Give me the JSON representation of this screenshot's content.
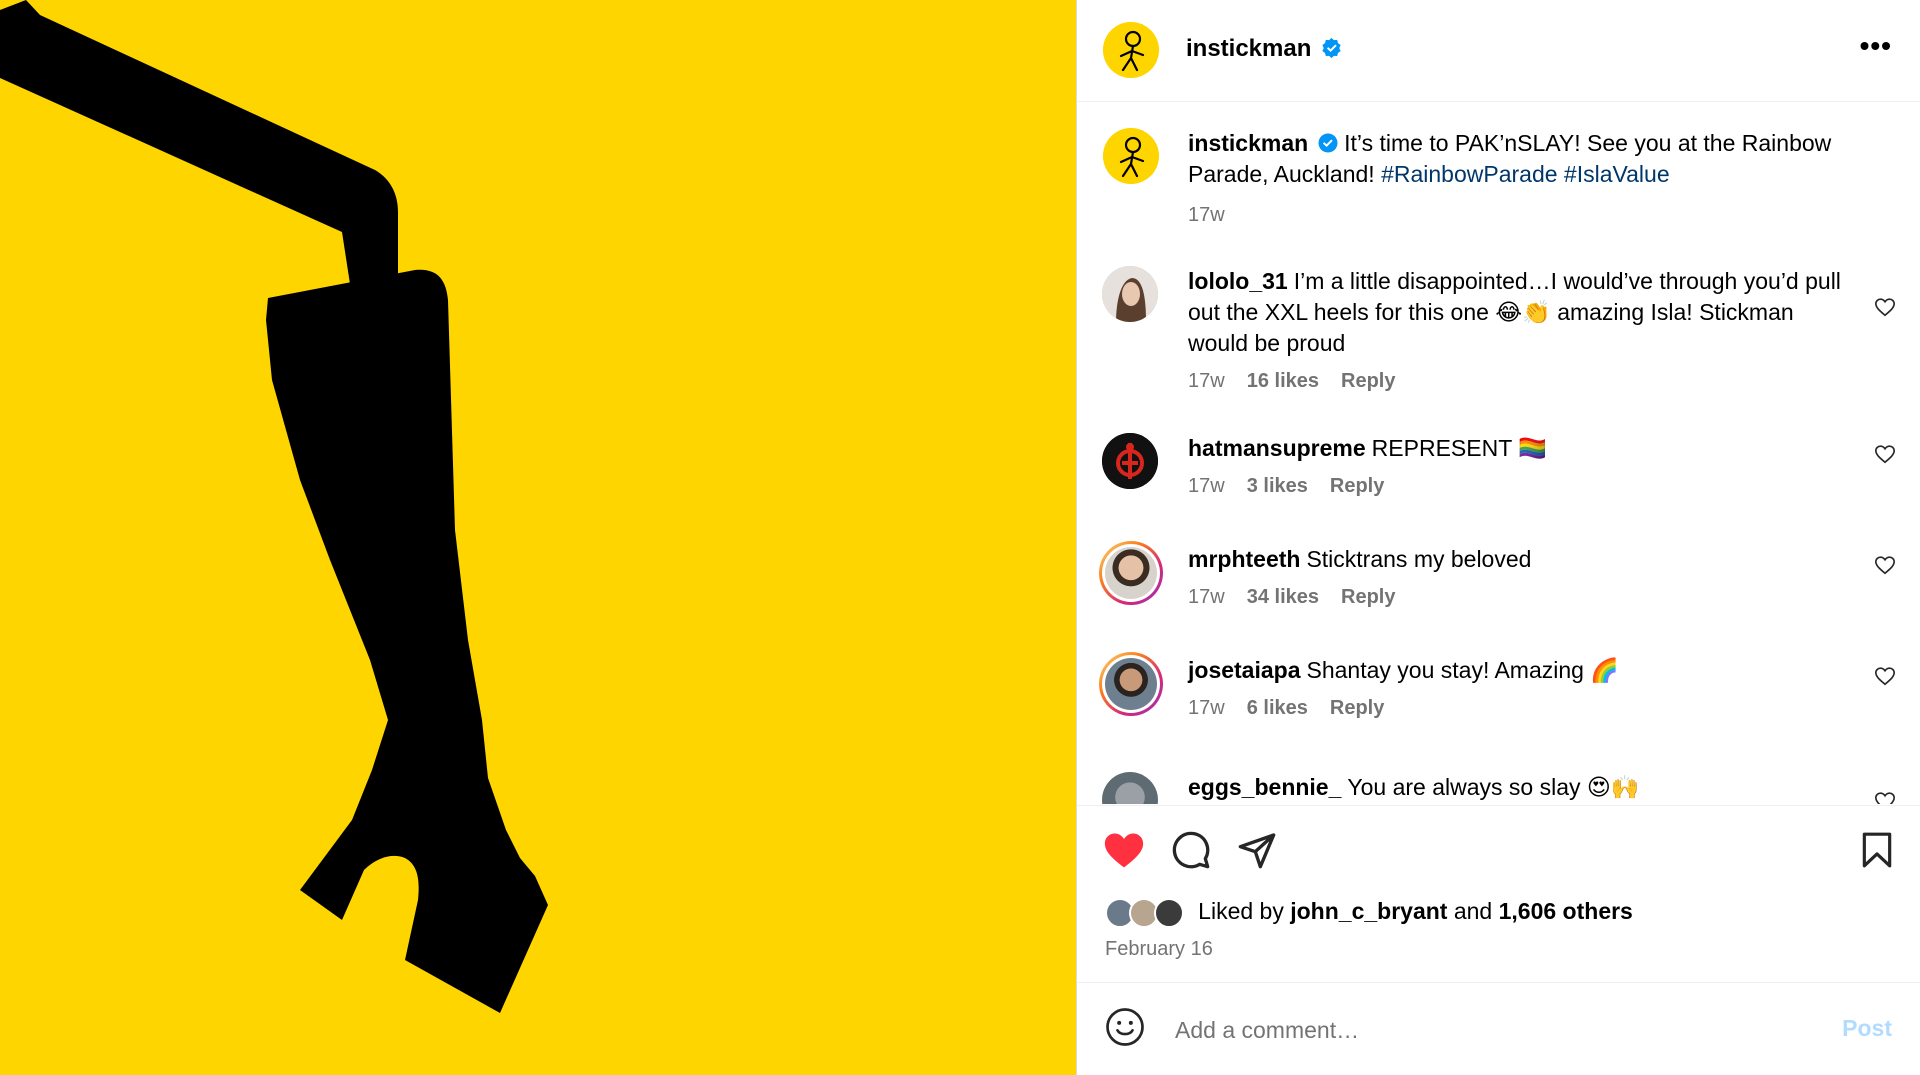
{
  "post": {
    "author": "instickman",
    "verified": true,
    "caption_author": "instickman",
    "caption_text": "It’s time to PAK’nSLAY! See you at the Rainbow Parade, Auckland!",
    "hashtags": [
      "#RainbowParade",
      "#IslaValue"
    ],
    "caption_time": "17w",
    "more_icon": "•••"
  },
  "comments": [
    {
      "user": "lololo_31",
      "text": "I’m a little disappointed…I would’ve through you’d pull out the XXL heels for this one 😂👏 amazing Isla! Stickman would be proud",
      "time": "17w",
      "likes": "16 likes",
      "reply": "Reply",
      "avatar_color": "#c9b3a3"
    },
    {
      "user": "hatmansupreme",
      "text": "REPRESENT 🏳️‍🌈",
      "time": "17w",
      "likes": "3 likes",
      "reply": "Reply",
      "avatar_color": "#111111"
    },
    {
      "user": "mrphteeth",
      "text": "Sticktrans my beloved",
      "time": "17w",
      "likes": "34 likes",
      "reply": "Reply",
      "avatar_color": "#a88873"
    },
    {
      "user": "josetaiapa",
      "text": "Shantay you stay! Amazing 🌈",
      "time": "17w",
      "likes": "6 likes",
      "reply": "Reply",
      "avatar_color": "#6e5a4c"
    },
    {
      "user": "eggs_bennie_",
      "text": "You are always so slay 😍🙌",
      "time": "",
      "likes": "",
      "reply": "",
      "avatar_color": "#8a8f95"
    }
  ],
  "actions": {
    "liked": true,
    "like_color": "#ff3040",
    "likes_prefix": "Liked by",
    "liked_by_user": "john_c_bryant",
    "likes_join": "and",
    "likes_others": "1,606 others",
    "date": "February 16",
    "liker_avatar_colors": [
      "#6b7a8a",
      "#b8a58f",
      "#3b3b3b"
    ]
  },
  "add_comment": {
    "placeholder": "Add a comment…",
    "post_label": "Post"
  },
  "icons": {
    "heart": "heart-icon",
    "comment": "comment-icon",
    "share": "share-icon",
    "save": "bookmark-icon",
    "emoji": "emoji-icon",
    "more": "more-options-icon",
    "verified": "verified-badge-icon"
  },
  "colors": {
    "media_background": "#ffd500",
    "silhouette": "#000000",
    "verified": "#0095f6",
    "hashtag": "#00376b",
    "post_disabled": "#b3dbff"
  }
}
